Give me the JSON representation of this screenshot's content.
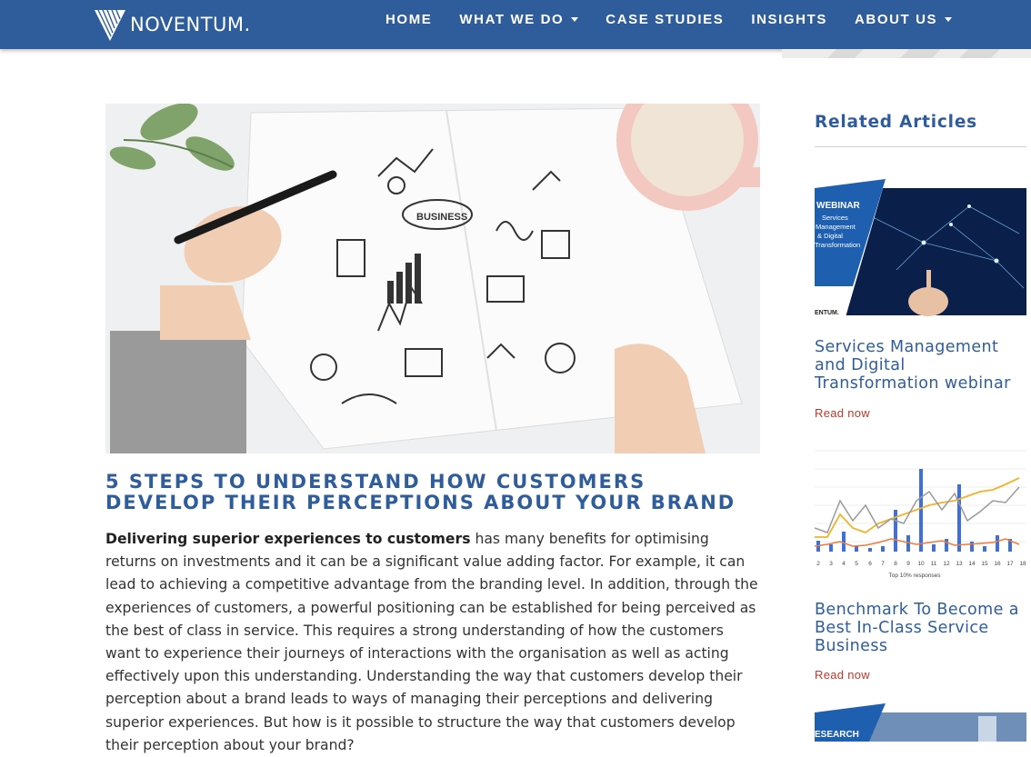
{
  "brand": {
    "name": "NOVENTUM."
  },
  "nav": {
    "items": [
      {
        "label": "HOME",
        "dropdown": false
      },
      {
        "label": "WHAT WE DO",
        "dropdown": true
      },
      {
        "label": "CASE STUDIES",
        "dropdown": false
      },
      {
        "label": "INSIGHTS",
        "dropdown": false
      },
      {
        "label": "ABOUT US",
        "dropdown": true
      }
    ]
  },
  "article": {
    "title": "5 STEPS TO UNDERSTAND HOW CUSTOMERS DEVELOP THEIR PERCEPTIONS ABOUT YOUR BRAND",
    "hero_sketch_label": "BUSINESS",
    "lead_bold": "Delivering superior experiences to customers",
    "body": " has many benefits for optimising returns on investments and it can be a significant value adding factor. For example, it can lead to achieving a competitive advantage from the branding level. In addition, through the experiences of customers, a powerful positioning can be established for being perceived as the best of class in service. This requires a strong understanding of how the customers want to experience their journeys of interactions with the organisation as well as acting effectively upon this understanding. Understanding the way that customers develop their perception about a brand leads to ways of managing their perceptions and delivering superior experiences. But how is it possible to structure the way that customers develop their perception about your brand?"
  },
  "sidebar": {
    "title": "Related Articles",
    "cards": [
      {
        "title": "Services Management and Digital Transformation webinar",
        "link": "Read now",
        "thumb": {
          "badge": "WEBINAR",
          "line1": "Services",
          "line2": "Management",
          "line3": "& Digital",
          "line4": "Transformation",
          "footer": "ENTUM."
        }
      },
      {
        "title": "Benchmark To Become a Best In-Class Service Business",
        "link": "Read now",
        "thumb": {
          "caption": "Top 10% responses",
          "x_labels": [
            "2",
            "3",
            "4",
            "5",
            "6",
            "7",
            "8",
            "9",
            "10",
            "11",
            "12",
            "13",
            "14",
            "15",
            "16",
            "17",
            "18"
          ]
        }
      },
      {
        "thumb": {
          "badge": "ESEARCH"
        }
      }
    ]
  },
  "colors": {
    "brand_blue": "#2f5d9b",
    "link_red": "#c0392b",
    "text": "#333333"
  }
}
